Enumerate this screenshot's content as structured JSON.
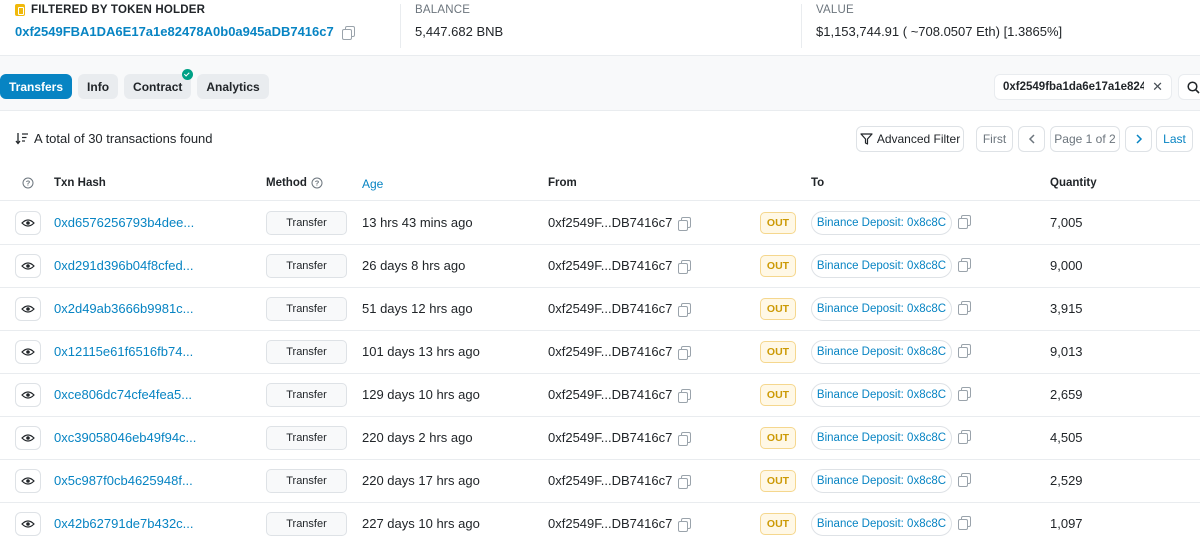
{
  "header": {
    "filtered_label": "FILTERED BY TOKEN HOLDER",
    "holder_address": "0xf2549FBA1DA6E17a1e82478A0b0a945aDB7416c7",
    "balance_label": "BALANCE",
    "balance_value": "5,447.682 BNB",
    "value_label": "VALUE",
    "value_value": "$1,153,744.91 ( ~708.0507 Eth) [1.3865%]"
  },
  "tabs": [
    {
      "label": "Transfers",
      "active": true
    },
    {
      "label": "Info"
    },
    {
      "label": "Contract",
      "verified": true
    },
    {
      "label": "Analytics"
    }
  ],
  "filter": {
    "address": "0xf2549fba1da6e17a1e824..."
  },
  "table": {
    "total_text": "A total of 30 transactions found",
    "advanced_filter": "Advanced Filter",
    "pagination": {
      "first": "First",
      "page": "Page 1 of 2",
      "last": "Last"
    },
    "columns": {
      "txn_hash": "Txn Hash",
      "method": "Method",
      "age": "Age",
      "from": "From",
      "to": "To",
      "quantity": "Quantity"
    },
    "rows": [
      {
        "hash": "0xd6576256793b4dee...",
        "method": "Transfer",
        "age": "13 hrs 43 mins ago",
        "from": "0xf2549F...DB7416c7",
        "dir": "OUT",
        "to": "Binance Deposit: 0x8c8C",
        "qty": "7,005"
      },
      {
        "hash": "0xd291d396b04f8cfed...",
        "method": "Transfer",
        "age": "26 days 8 hrs ago",
        "from": "0xf2549F...DB7416c7",
        "dir": "OUT",
        "to": "Binance Deposit: 0x8c8C",
        "qty": "9,000"
      },
      {
        "hash": "0x2d49ab3666b9981c...",
        "method": "Transfer",
        "age": "51 days 12 hrs ago",
        "from": "0xf2549F...DB7416c7",
        "dir": "OUT",
        "to": "Binance Deposit: 0x8c8C",
        "qty": "3,915"
      },
      {
        "hash": "0x12115e61f6516fb74...",
        "method": "Transfer",
        "age": "101 days 13 hrs ago",
        "from": "0xf2549F...DB7416c7",
        "dir": "OUT",
        "to": "Binance Deposit: 0x8c8C",
        "qty": "9,013"
      },
      {
        "hash": "0xce806dc74cfe4fea5...",
        "method": "Transfer",
        "age": "129 days 10 hrs ago",
        "from": "0xf2549F...DB7416c7",
        "dir": "OUT",
        "to": "Binance Deposit: 0x8c8C",
        "qty": "2,659"
      },
      {
        "hash": "0xc39058046eb49f94c...",
        "method": "Transfer",
        "age": "220 days 2 hrs ago",
        "from": "0xf2549F...DB7416c7",
        "dir": "OUT",
        "to": "Binance Deposit: 0x8c8C",
        "qty": "4,505"
      },
      {
        "hash": "0x5c987f0cb4625948f...",
        "method": "Transfer",
        "age": "220 days 17 hrs ago",
        "from": "0xf2549F...DB7416c7",
        "dir": "OUT",
        "to": "Binance Deposit: 0x8c8C",
        "qty": "2,529"
      },
      {
        "hash": "0x42b62791de7b432c...",
        "method": "Transfer",
        "age": "227 days 10 hrs ago",
        "from": "0xf2549F...DB7416c7",
        "dir": "OUT",
        "to": "Binance Deposit: 0x8c8C",
        "qty": "1,097"
      }
    ]
  },
  "icons": {
    "holder": "token-holder-icon",
    "copy": "copy-icon",
    "sort": "sort-desc-icon",
    "help": "question-circle-icon",
    "filter": "filter-icon",
    "eye": "eye-icon",
    "search": "search-icon",
    "close": "close-icon"
  },
  "colors": {
    "accent": "#0784c3",
    "out_badge": "#cc9a06",
    "verified": "#00a186",
    "holder_badge": "#f0b90b"
  }
}
